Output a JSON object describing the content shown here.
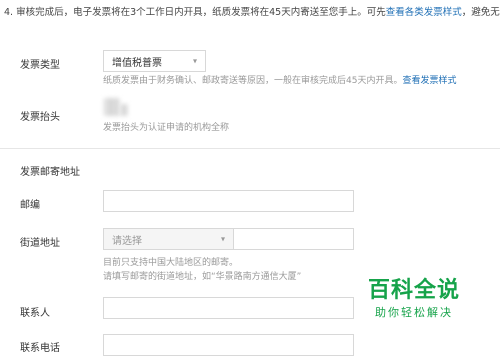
{
  "notice": {
    "text_before": "4. 审核完成后，电子发票将在3个工作日内开具，纸质发票将在45天内寄送至您手上。可先",
    "link": "查看各类发票样式",
    "text_after": "，避免无法报销。"
  },
  "invoice_type": {
    "label": "发票类型",
    "selected": "增值税普票",
    "hint": "纸质发票由于财务确认、邮政寄送等原因，一般在审核完成后45天内开具。",
    "hint_link": "查看发票样式"
  },
  "invoice_title": {
    "label": "发票抬头",
    "hint": "发票抬头为认证申请的机构全称"
  },
  "mailing_section": {
    "title": "发票邮寄地址"
  },
  "postcode": {
    "label": "邮编",
    "value": ""
  },
  "street": {
    "label": "街道地址",
    "region_placeholder": "请选择",
    "address_value": "",
    "hint_line1": "目前只支持中国大陆地区的邮寄。",
    "hint_line2": "请填写邮寄的街道地址，如“华景路南方通信大厦”"
  },
  "contact": {
    "label": "联系人",
    "value": ""
  },
  "phone": {
    "label": "联系电话",
    "value": ""
  },
  "watermark": {
    "title": "百科全说",
    "subtitle": "助你轻松解决",
    "color": "#16a34a"
  },
  "colors": {
    "link": "#1f6fb5",
    "hint": "#999999",
    "border": "#d8d8d8"
  }
}
